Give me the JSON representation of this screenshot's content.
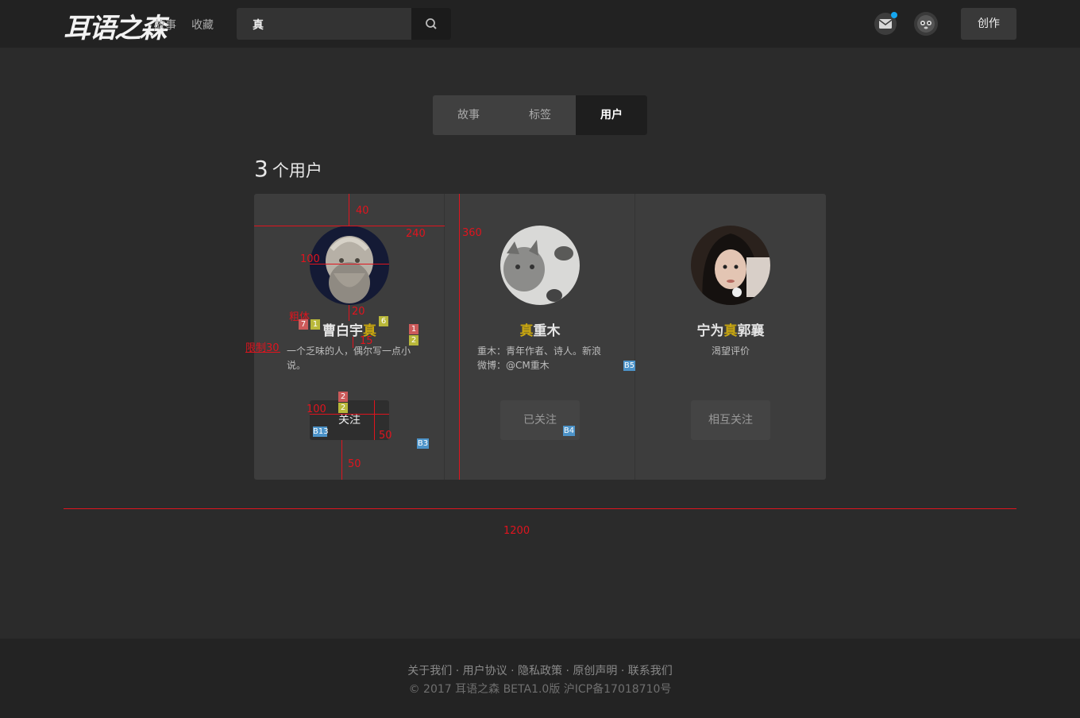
{
  "header": {
    "logo": "耳语之森",
    "nav": [
      "故事",
      "收藏"
    ],
    "search_value": "真",
    "create_label": "创作"
  },
  "tabs": [
    "故事",
    "标签",
    "用户"
  ],
  "active_tab": "用户",
  "result": {
    "count": "3",
    "unit": "个用户"
  },
  "users": [
    {
      "name_before": "曹白宇",
      "name_hl": "真",
      "name_after": "",
      "bio": [
        "一个乏味的人，偶尔写一点小",
        "说。"
      ],
      "button": "关注"
    },
    {
      "name_before": "",
      "name_hl": "真",
      "name_after": "重木",
      "bio": [
        "重木：青年作者、诗人。新浪",
        "微博：@CM重木"
      ],
      "button": "已关注"
    },
    {
      "name_before": "宁为",
      "name_hl": "真",
      "name_after": "郭襄",
      "bio": [
        "渴望评价"
      ],
      "button": "相互关注"
    }
  ],
  "annotations": {
    "a40": "40",
    "a240": "240",
    "a360": "360",
    "a100_avatar": "100",
    "a20": "20",
    "a15": "15",
    "a_cuti": "粗体",
    "a_limit": "限制30",
    "a100_btn": "100",
    "a50_btn": "50",
    "a50_bottom": "50",
    "a1200": "1200",
    "m7": "7",
    "m1": "1",
    "m6": "6",
    "m1b": "1",
    "m2": "2",
    "m2b": "2",
    "m2c": "2",
    "b13": "B13",
    "b3": "B3",
    "b4": "B4",
    "b5": "B5"
  },
  "footer": {
    "links": [
      "关于我们",
      "用户协议",
      "隐私政策",
      "原创声明",
      "联系我们"
    ],
    "separator": "·",
    "copyright": "© 2017 耳语之森 BETA1.0版 沪ICP备17018710号"
  },
  "colors": {
    "highlight": "#c8a610",
    "annotation": "#e0141e",
    "notify": "#15a6f0"
  }
}
